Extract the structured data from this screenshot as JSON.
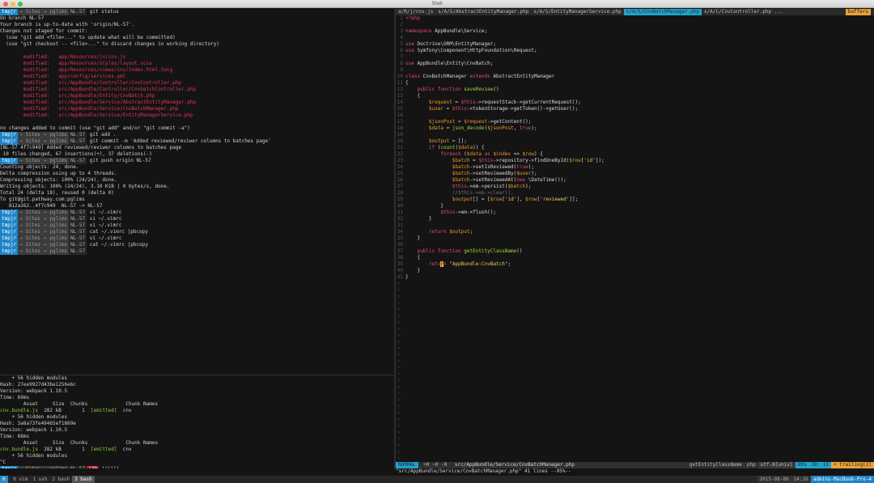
{
  "window": {
    "title": "Shell"
  },
  "prompt": {
    "user": "tmpjr",
    "sep": "→",
    "path1": "Sites",
    "path2": "pglims",
    "branch": "NL-57"
  },
  "left_pane": [
    {
      "p": 1,
      "cmd": "git status"
    },
    {
      "t": "On branch NL-57"
    },
    {
      "t": "Your branch is up-to-date with 'origin/NL-57'."
    },
    {
      "t": "Changes not staged for commit:"
    },
    {
      "t": "  (use \"git add <file>...\" to update what will be committed)"
    },
    {
      "t": "  (use \"git checkout -- <file>...\" to discard changes in working directory)"
    },
    {
      "t": ""
    },
    {
      "mod": "app/Resources/js/cnv.js"
    },
    {
      "mod": "app/Resources/styles/layout.scss"
    },
    {
      "mod": "app/Resources/views/cnv/index.html.twig"
    },
    {
      "mod": "app/config/services.yml"
    },
    {
      "mod": "src/AppBundle/Controller/CnvController.php"
    },
    {
      "mod": "src/AppBundle/Controller/CnvbatchController.php"
    },
    {
      "mod": "src/AppBundle/Entity/CnvBatch.php"
    },
    {
      "mod": "src/AppBundle/Service/AbstractEntityManager.php"
    },
    {
      "mod": "src/AppBundle/Service/CnvBatchManager.php"
    },
    {
      "mod": "src/AppBundle/Service/EntityManagerService.php"
    },
    {
      "t": ""
    },
    {
      "t": "no changes added to commit (use \"git add\" and/or \"git commit -a\")"
    },
    {
      "p": 1,
      "cmd": "git add ."
    },
    {
      "p": 1,
      "cmd": "git commit -m 'Added reviewed/reviwer columns to batches page'"
    },
    {
      "t": "[NL-57 4f7c949] Added reviewed/reviwer columns to batches page"
    },
    {
      "t": " 10 files changed, 67 insertions(+), 37 deletions(-)"
    },
    {
      "p": 1,
      "cmd": "git push origin NL-57"
    },
    {
      "t": "Counting objects: 24, done."
    },
    {
      "t": "Delta compression using up to 4 threads."
    },
    {
      "t": "Compressing objects: 100% (24/24), done."
    },
    {
      "t": "Writing objects: 100% (24/24), 3.10 KiB | 0 bytes/s, done."
    },
    {
      "t": "Total 24 (delta 18), reused 0 (delta 0)"
    },
    {
      "t": "To git@git.pathway.com:pglims"
    },
    {
      "t": "   812a262..4f7c949  NL-57 -> NL-57"
    },
    {
      "p": 1,
      "cmd": "vi ~/.vimrc"
    },
    {
      "p": 1,
      "cmd": "vi ~/.vimrc"
    },
    {
      "p": 1,
      "cmd": "vi ~/.vimrc"
    },
    {
      "p": 1,
      "cmd": "cat ~/.vimrc |pbcopy"
    },
    {
      "p": 1,
      "cmd": "vi ~/.vimrc"
    },
    {
      "p": 1,
      "cmd": "cat ~/.vimrc |pbcopy"
    },
    {
      "p": 1,
      "cmd": ""
    }
  ],
  "bottom_pane": [
    {
      "t": "    + 56 hidden modules"
    },
    {
      "t": "Hash: 27ee9927d43be1256e6c"
    },
    {
      "t": "Version: webpack 1.10.5"
    },
    {
      "t": "Time: 69ms"
    },
    {
      "t": "        Asset     Size  Chunks             Chunk Names"
    },
    {
      "asset": "cnv.bundle.js",
      "size": "282 kB",
      "chunk": "1",
      "emitted": "[emitted]",
      "name": "cnv"
    },
    {
      "t": "    + 56 hidden modules"
    },
    {
      "t": "Hash: 3a8a73fe49465ef1869e"
    },
    {
      "t": "Version: webpack 1.10.5"
    },
    {
      "t": "Time: 68ms"
    },
    {
      "t": "        Asset     Size  Chunks             Chunk Names"
    },
    {
      "asset": "cnv.bundle.js",
      "size": "282 kB",
      "chunk": "1",
      "emitted": "[emitted]",
      "name": "cnv"
    },
    {
      "t": "    + 56 hidden modules"
    },
    {
      "t": "^C"
    },
    {
      "p": 1,
      "err": "130",
      "cmd": "jjjjjj"
    }
  ],
  "tabs": [
    {
      "label": "a/R/j/cnv.js",
      "active": false
    },
    {
      "label": "s/A/S/AbstractEntityManager.php",
      "active": false
    },
    {
      "label": "s/A/S/EntityManagerService.php",
      "active": false
    },
    {
      "label": "s/A/S/CnvBatchManager.php",
      "active": true
    },
    {
      "label": "s/A/C/CnvController.php ...",
      "active": false
    }
  ],
  "buffers_label": "buffers",
  "code": [
    [
      [
        "kw",
        "<?php"
      ]
    ],
    [],
    [
      [
        "kw",
        "namespace"
      ],
      [
        "ty",
        " AppBundle\\Service;"
      ]
    ],
    [],
    [
      [
        "kw",
        "use"
      ],
      [
        "ty",
        " Doctrine\\ORM\\EntityManager;"
      ]
    ],
    [
      [
        "kw",
        "use"
      ],
      [
        "ty",
        " Symfony\\Component\\HttpFoundation\\Request;"
      ]
    ],
    [],
    [
      [
        "kw",
        "use"
      ],
      [
        "ty",
        " AppBundle\\Entity\\CnvBatch;"
      ]
    ],
    [],
    [
      [
        "kw",
        "class"
      ],
      [
        "ty",
        " CnvBatchManager "
      ],
      [
        "kw",
        "extends"
      ],
      [
        "ty",
        " AbstractEntityManager"
      ]
    ],
    [
      [
        "ty",
        "{"
      ]
    ],
    [
      [
        "ty",
        "    "
      ],
      [
        "kw",
        "public function"
      ],
      [
        "fn",
        " saveReview"
      ],
      [
        "ty",
        "()"
      ]
    ],
    [
      [
        "ty",
        "    {"
      ]
    ],
    [
      [
        "ty",
        "        "
      ],
      [
        "vr",
        "$request"
      ],
      [
        "ty",
        " = "
      ],
      [
        "th",
        "$this"
      ],
      [
        "ty",
        "->requestStack->getCurrentRequest();"
      ]
    ],
    [
      [
        "ty",
        "        "
      ],
      [
        "vr",
        "$user"
      ],
      [
        "ty",
        " = "
      ],
      [
        "th",
        "$this"
      ],
      [
        "ty",
        "->tokenStorage->getToken()->getUser();"
      ]
    ],
    [],
    [
      [
        "ty",
        "        "
      ],
      [
        "vr",
        "$jsonPost"
      ],
      [
        "ty",
        " = "
      ],
      [
        "vr",
        "$request"
      ],
      [
        "ty",
        "->getContent();"
      ]
    ],
    [
      [
        "ty",
        "        "
      ],
      [
        "vr",
        "$data"
      ],
      [
        "ty",
        " = "
      ],
      [
        "fn",
        "json_decode"
      ],
      [
        "ty",
        "("
      ],
      [
        "vr",
        "$jsonPost"
      ],
      [
        "ty",
        ", "
      ],
      [
        "kw",
        "true"
      ],
      [
        "ty",
        ");"
      ]
    ],
    [],
    [
      [
        "ty",
        "        "
      ],
      [
        "vr",
        "$output"
      ],
      [
        "ty",
        " = [];"
      ]
    ],
    [
      [
        "ty",
        "        "
      ],
      [
        "kw",
        "if"
      ],
      [
        "ty",
        " ("
      ],
      [
        "fn",
        "count"
      ],
      [
        "ty",
        "("
      ],
      [
        "vr",
        "$data"
      ],
      [
        "ty",
        ")) {"
      ]
    ],
    [
      [
        "ty",
        "            "
      ],
      [
        "kw",
        "foreach"
      ],
      [
        "ty",
        " ("
      ],
      [
        "vr",
        "$data"
      ],
      [
        "kw",
        " as "
      ],
      [
        "vr",
        "$index"
      ],
      [
        "ty",
        " => "
      ],
      [
        "vr",
        "$row"
      ],
      [
        "ty",
        ") {"
      ]
    ],
    [
      [
        "ty",
        "                "
      ],
      [
        "vr",
        "$batch"
      ],
      [
        "ty",
        " = "
      ],
      [
        "th",
        "$this"
      ],
      [
        "ty",
        "->repository->findOneById("
      ],
      [
        "vr",
        "$row"
      ],
      [
        "ty",
        "["
      ],
      [
        "st",
        "'id'"
      ],
      [
        "ty",
        "]);"
      ]
    ],
    [
      [
        "ty",
        "                "
      ],
      [
        "vr",
        "$batch"
      ],
      [
        "ty",
        "->setIsReviewed("
      ],
      [
        "kw",
        "true"
      ],
      [
        "ty",
        ");"
      ]
    ],
    [
      [
        "ty",
        "                "
      ],
      [
        "vr",
        "$batch"
      ],
      [
        "ty",
        "->setReviewedBy("
      ],
      [
        "vr",
        "$user"
      ],
      [
        "ty",
        ");"
      ]
    ],
    [
      [
        "ty",
        "                "
      ],
      [
        "vr",
        "$batch"
      ],
      [
        "ty",
        "->setReviewedAt("
      ],
      [
        "kw",
        "new"
      ],
      [
        "ty",
        " \\DateTime());"
      ]
    ],
    [
      [
        "ty",
        "                "
      ],
      [
        "th",
        "$this"
      ],
      [
        "ty",
        "->em->persist("
      ],
      [
        "vr",
        "$batch"
      ],
      [
        "ty",
        ");"
      ]
    ],
    [
      [
        "cm",
        "                //$this->em->clear();"
      ]
    ],
    [
      [
        "ty",
        "                "
      ],
      [
        "vr",
        "$output"
      ],
      [
        "ty",
        "[] = ["
      ],
      [
        "vr",
        "$row"
      ],
      [
        "ty",
        "["
      ],
      [
        "st",
        "'id'"
      ],
      [
        "ty",
        "], "
      ],
      [
        "vr",
        "$row"
      ],
      [
        "ty",
        "["
      ],
      [
        "st",
        "'reviewed'"
      ],
      [
        "ty",
        "]];"
      ]
    ],
    [
      [
        "ty",
        "            }"
      ]
    ],
    [
      [
        "ty",
        "            "
      ],
      [
        "th",
        "$this"
      ],
      [
        "ty",
        "->em->flush();"
      ]
    ],
    [
      [
        "ty",
        "        }"
      ]
    ],
    [],
    [
      [
        "ty",
        "        "
      ],
      [
        "kw",
        "return"
      ],
      [
        "vr",
        " $output"
      ],
      [
        "ty",
        ";"
      ]
    ],
    [
      [
        "ty",
        "    }"
      ]
    ],
    [],
    [
      [
        "ty",
        "    "
      ],
      [
        "kw",
        "public function"
      ],
      [
        "fn",
        " getEntityClassName"
      ],
      [
        "ty",
        "()"
      ]
    ],
    [
      [
        "ty",
        "    {"
      ]
    ],
    [
      [
        "ty",
        "        "
      ],
      [
        "kw",
        "retu"
      ],
      [
        "cur",
        "r"
      ],
      [
        "kw",
        "n"
      ],
      [
        "st",
        " \"AppBundle:CnvBatch\""
      ],
      [
        "ty",
        ";"
      ]
    ],
    [
      [
        "ty",
        "    }"
      ]
    ],
    [
      [
        "ty",
        "}"
      ]
    ]
  ],
  "tilde_count": 28,
  "statusline": {
    "mode": "NORMAL",
    "git": "+0 ~0 -0",
    "file": "src/AppBundle/Service/CnvBatchManager.php",
    "func": "getEntityClassName",
    "filetype": "php",
    "encoding": "utf-8[unix]",
    "percent": "95%",
    "position": "39:  13",
    "warning": "• trailing[2]"
  },
  "cmdline": "\"src/AppBundle/Service/CnvBatchManager.php\" 41 lines --95%--",
  "tmux": {
    "session": "0",
    "windows": [
      "0  vim",
      "1  ssh",
      "2  bash",
      "3  bash"
    ],
    "current": 3,
    "date": "2015-08-06",
    "time": "14:26",
    "host": "admins-MacBook-Pro-4"
  },
  "colors": {
    "accent": "#21a2c8",
    "prompt_user": "#1e84c8",
    "modified": "#e0355c",
    "keyword": "#e04a7a",
    "variable": "#f09a2a",
    "function": "#a0d83c",
    "buffers": "#e8a23c"
  }
}
